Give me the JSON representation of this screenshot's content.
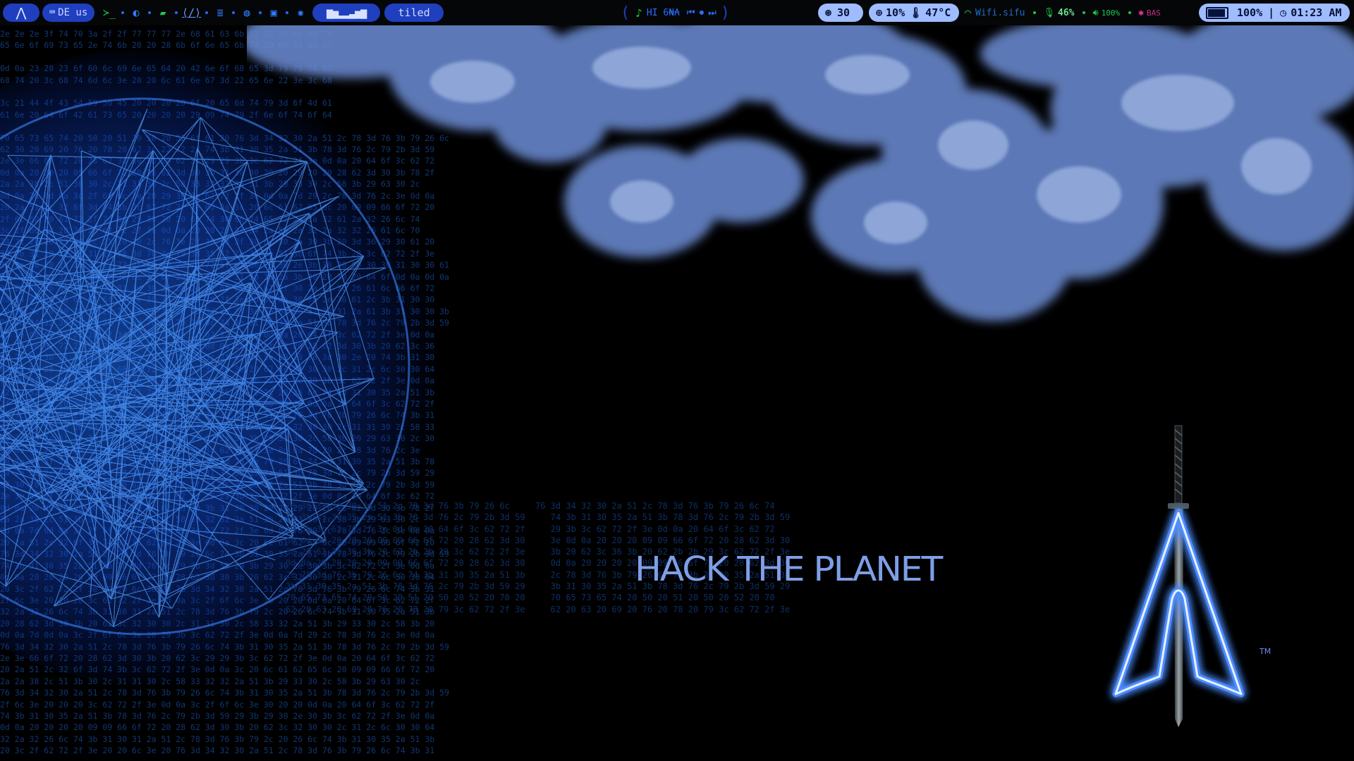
{
  "topbar": {
    "launcher": {
      "icon": "arch-logo-icon"
    },
    "layout": {
      "label": "DE us"
    },
    "apps": [
      {
        "icon": "terminal-icon",
        "glyph": "≻_"
      },
      {
        "icon": "firefox-icon",
        "glyph": "◐"
      },
      {
        "icon": "files-icon",
        "glyph": "▰"
      },
      {
        "icon": "code-icon",
        "glyph": "⟨/⟩"
      },
      {
        "icon": "notes-icon",
        "glyph": "≣"
      },
      {
        "icon": "chat-icon",
        "glyph": "◍"
      },
      {
        "icon": "video-icon",
        "glyph": "▣"
      },
      {
        "icon": "settings-icon",
        "glyph": "✺"
      }
    ],
    "equalizer_label": "▆▅▂▂▃▅▆",
    "workspace": {
      "label": "tiled"
    },
    "media": {
      "title": "HI 6₦₳",
      "prev": "⏮",
      "play": "⏺",
      "next": "⏭"
    },
    "updates": {
      "icon": "arch-update-icon",
      "value": "30"
    },
    "cpu": {
      "icon": "cpu-icon",
      "value": "10%"
    },
    "temp": {
      "icon": "thermometer-icon",
      "value": "47°C"
    },
    "wifi": {
      "icon": "wifi-icon",
      "label": "Wifi.sifu"
    },
    "mic": {
      "icon": "microphone-icon",
      "value": "46%"
    },
    "volume": {
      "icon": "speaker-icon",
      "value": "100%"
    },
    "bluetooth": {
      "icon": "bluetooth-icon",
      "value": "BAS"
    },
    "battery": {
      "icon": "battery-icon",
      "value": "100%",
      "level": 1.0
    },
    "clock": {
      "icon": "clock-icon",
      "value": "01:23 AM"
    }
  },
  "wallpaper": {
    "headline": "HACK THE PLANET",
    "trademark": "TM",
    "hex_lines": [
      "2e 2e 2e 3f 74 70 3a 2f 2f 77 77 77 2e 68 61 63 6b 65 72 2e 6e 65 74",
      "65 6e 6f 69 73 65 2e 74 6b 20 20 28 6b 6f 6e 65 6b 74 20 64 65 6e 6f",
      "",
      "0d 0a 23 20 23 6f 60 6c 69 6e 65 64 20 42 6e 6f 68 65 3d 79 79 74 65",
      "68 74 20 3c 68 74 6d 6c 3e 20 20 6c 61 6e 67 3d 22 65 6e 22 3e 3c 68",
      "",
      "3c 21 44 4f 43 54 59 50 45 20 20 20 20 6f 20 65 6d 74 79 3d 6f 4d 61",
      "61 6e 20 64 6f 42 61 73 65 20 20 20 20 29 09 74 79 2f 6e 6f 74 6f 64",
      "",
      "70 65 73 65 74 20 50 20 51 20 50 20 52 6f 61 20 76 3d 34 32 30 2a 51 2c 78 3d 76 3b 79 26 6c",
      "62 30 20 69 20 76 20 78 20 62 3c 22 72 2f 74 3b 31 30 35 2a 51 3b 78 3d 76 2c 79 2b 3d 59",
      "2e 3e 66 6f 72 20 28 62 3d 30 3b 20 62 3c 29 29 3b 3c 62 72 2f 3e 0d 0a 20 64 6f 3c 62 72",
      "0d 0a 20 20 20 09 66 6f 72 20 28 62 3d 30 3b 31 30 30 20 20 29 20 20 28 62 3d 30 3b 78 2f",
      "2a 2a 38 2c 51 3b 30 2c 31 31 30 2c 58 33 32 32 2a 51 3b 29 33 30 2c 58 3b 29 63 30 2c",
      "0d 0a 7d 0d 0a 3c 2f 6f 6c 3e 20 29 3b 3c 62 72 2f 3e 0d 0a 7d 29 2c 78 3d 76 2c 3e 0d 0a",
      "20 2a 51 2c 32 6f 3d 74 3b 3c 62 72 2f 3e 0d 0a 3c 20 6c 61 62 65 6c 20 09 09 66 6f 72 20",
      "2f 6c 62 20 61 73 2f 7d 6e 29 30 20 20 61 74 30 66 74 65 72 2a 2a 32 61 2a 32 26 6c 74",
      "3c 2f 66 20 20 20 20 62 72 2f 3e 0d 0a 20 20 20 34 34 2a 50 2a 32 2a 32 32 26 61 6c 70",
      "74 2c 20 20 33 30 2c 21 20 20 2c 76 3e 2f 30 3a 3f 30 6c 30 3a 30 3b 20 3d 36 29 30 61 20",
      "74 3b 31 30 2c 2e 31 2a 78 3d 76 2c 79 3d 35 32 2e 33 3a 51 3b 6f 74 3b 28 3c 62 72 2f 3e",
      "3d 3e 30 20 20 20 3c 62 72 2f 3e 30 2e 70 72 6f 6f 66 20 30 2e 3b 30 30 50 30 30 31 30 30 61",
      "35 6f 32 30 31 33 20 6e 20 6c 20 6f 20 32 30 2e 31 20 30 2a 3b 30 20 30 20 64 6f 0d 0a 0d 0a",
      "30 20 30 3b 31 30 2c 36 31 3d 30 20 2a 2e 72 6f 6f 78 61 2f 30 2a 2f 36 26 61 6c 66 6f 72",
      "0a 64 6f 6e 65 62 64 6f 74 2e 36 34 20 30 20 2f 3e 3b 3b 2a 30 78 2e 36 61 2c 3b 31 30 30",
      "20 3f 2e 30 30 20 3f 20 20 20 20 30 20 78 3d 79 2f 3e 3e 0d 0a 32 32 31 2a 61 3b 31 30 30 3b",
      "76 3d 34 32 30 2a 51 2c 78 3d 76 3b 79 26 6c 74 3b 31 30 35 2a 51 3b 78 3d 76 2c 79 2b 3d 59",
      "2d 3e 66 6f 72 20 28 62 3d 30 3b 29 3b 3c 62 72 2f 3e 0d 0a 20 64 6f 3c 62 72 2f 3e 0d 0a",
      "20 20 3c 62 72 2f 3e 20 20 20 20 2e 30 30 0d 0a 20 66 6f 72 20 28 62 3d 30 3b 20 62 3c 36",
      "6f 2f 6c 3b 31 30 2a 6d 2f 62 76 3e 0d 0a 3c 2f 6f 6c 3e 20 20 78 3d 30 2e 20 74 3b 31 30",
      "0d 0a 20 20 20 20 09 09 66 6f 72 20 28 62 3d 30 3b 20 62 3c 32 30 30 2c 31 2c 6c 30 30 64",
      "74 3b 31 30 35 2a 51 3b 78 3d 76 2c 79 2b 3d 59 29 3b 29 30 2e 30 3b 3c 62 72 2f 3e 0d 0a",
      "32 2a 32 26 6c 74 3b 31 30 31 2a 51 2c 78 3d 76 3b 79 2c 20 26 6c 74 3b 31 30 35 2a 51 3b",
      "2f 6c 3e 20 20 20 3c 62 72 2f 3e 0d 0a 3c 2f 6f 6c 3e 30 20 20 0d 0a 20 64 6f 3c 62 72 2f",
      "20 3c 2f 62 72 2f 3e 20 20 6c 3e 20 76 3d 34 32 30 2a 51 2c 78 3d 76 3b 79 26 6c 74 3b 31",
      "0d 0a 20 20 20 20 09 09 66 6f 72 20 28 62 3d 30 3b 20 62 3c 32 30 30 2c 31 31 30 2c 58 33",
      "2a 2a 38 2c 51 3b 30 2c 31 31 30 2c 58 33 32 2a 51 3b 29 33 30 2c 58 3b 20 29 63 30 2c 30",
      "3e 0d 0a 7d 0d 0a 3c 2f 6f 6c 3e 20 29 3b 3c 62 72 2f 3e 0d 0a 7d 29 2c 78 3d 76 2c 3e",
      "30 2a 51 2f 26 6c 74 3b 31 30 35 2a 51 2c 78 3d 76 3b 79 26 6c 74 3b 31 30 35 2a 51 3b 78",
      "2a 2a 32 2c 38 2a 32 2a 32 30 26 6c 74 3b 31 30 30 35 2a 51 3b 78 3d 76 2c 79 2b 3d 59 29",
      "62 30 20 69 20 76 20 78 20 62 3c 22 72 2f 74 3b 31 30 35 2a 51 3b 78 3d 76 2c 79 2b 3d 59",
      "2e 3e 66 6f 72 20 28 62 3d 30 3b 20 62 3c 29 29 3b 3c 62 72 2f 3e 0d 0a 20 64 6f 3c 62 72",
      "0d 0a 20 20 20 09 66 6f 72 20 28 62 3d 30 3b 31 30 30 20 20 29 20 20 28 62 3d 30 3b 78 2f",
      "2a 2a 38 2c 51 3b 30 2c 31 31 30 2c 58 33 32 32 2a 51 3b 29 33 30 2c 58 3b 29 63 30 2c",
      "0d 0a 7d 0d 0a 3c 2f 6f 6c 3e 20 29 3b 3c 62 72 2f 3e 0d 0a 7d 29 2c 78 3d 76 2c 3e 0d 0a",
      "20 2a 51 2c 32 6f 3d 74 3b 3c 62 72 2f 3e 0d 0a 3c 20 6c 61 62 65 6c 20 09 09 66 6f 72 20",
      "76 3d 34 32 30 2a 51 2c 78 3d 76 3b 79 26 6c 74 3b 31 30 35 2a 51 3b 78 3d 76 2c 79 2b 3d 59",
      "74 3b 31 30 35 2a 51 3b 78 3d 76 2c 79 2b 3d 59 29 3b 29 30 2e 30 3b 3c 62 72 2f 3e 0d 0a",
      "0d 0a 20 20 20 20 09 09 66 6f 72 20 28 62 3d 30 3b 20 62 3c 32 30 30 2c 31 2c 6c 30 30 64",
      "20 3c 2f 62 72 2f 3e 20 20 6c 3e 20 76 3d 34 32 30 2a 51 2c 78 3d 76 3b 79 26 6c 74 3b 31",
      "2f 6c 3e 20 20 20 3c 62 72 2f 3e 0d 0a 3c 2f 6f 6c 3e 30 20 20 0d 0a 20 64 6f 3c 62 72 2f",
      "32 2a 32 26 6c 74 3b 31 30 31 2a 51 2c 78 3d 76 3b 79 2c 20 26 6c 74 3b 31 30 35 2a 51 3b",
      "20 28 62 3d 30 3b 20 62 3c 32 30 30 2c 31 31 30 2c 58 33 32 2a 51 3b 29 33 30 2c 58 3b 20",
      "0d 0a 7d 0d 0a 3c 2f 6f 6c 3e 20 29 3b 3c 62 72 2f 3e 0d 0a 7d 29 2c 78 3d 76 2c 3e 0d 0a",
      "76 3d 34 32 30 2a 51 2c 78 3d 76 3b 79 26 6c 74 3b 31 30 35 2a 51 3b 78 3d 76 2c 79 2b 3d 59",
      "2e 3e 66 6f 72 20 28 62 3d 30 3b 20 62 3c 29 29 3b 3c 62 72 2f 3e 0d 0a 20 64 6f 3c 62 72",
      "20 2a 51 2c 32 6f 3d 74 3b 3c 62 72 2f 3e 0d 0a 3c 20 6c 61 62 65 6c 20 09 09 66 6f 72 20",
      "2a 2a 38 2c 51 3b 30 2c 31 31 30 2c 58 33 32 32 2a 51 3b 29 33 30 2c 58 3b 29 63 30 2c",
      "76 3d 34 32 30 2a 51 2c 78 3d 76 3b 79 26 6c 74 3b 31 30 35 2a 51 3b 78 3d 76 2c 79 2b 3d 59",
      "2f 6c 3e 20 20 20 3c 62 72 2f 3e 0d 0a 3c 2f 6f 6c 3e 30 20 20 0d 0a 20 64 6f 3c 62 72 2f",
      "74 3b 31 30 35 2a 51 3b 78 3d 76 2c 79 2b 3d 59 29 3b 29 30 2e 30 3b 3c 62 72 2f 3e 0d 0a",
      "0d 0a 20 20 20 20 09 09 66 6f 72 20 28 62 3d 30 3b 20 62 3c 32 30 30 2c 31 2c 6c 30 30 64",
      "32 2a 32 26 6c 74 3b 31 30 31 2a 51 2c 78 3d 76 3b 79 2c 20 26 6c 74 3b 31 30 35 2a 51 3b",
      "20 3c 2f 62 72 2f 3e 20 20 6c 3e 20 76 3d 34 32 30 2a 51 2c 78 3d 76 3b 79 26 6c 74 3b 31"
    ],
    "hex_block": [
      "76 3d 34 32 30 2a 51 2c 78 3d 76 3b 79 26 6c     76 3d 34 32 30 2a 51 2c 78 3d 76 3b 79 26 6c 74",
      "74 3b 31 30 35 2a 51 3b 78 3d 76 2c 79 2b 3d 59     74 3b 31 30 35 2a 51 3b 78 3d 76 2c 79 2b 3d 59",
      "29 3b 3c 62 72 2f 3e 0d 0a 20 64 6f 3c 62 72 2f     29 3b 3c 62 72 2f 3e 0d 0a 20 64 6f 3c 62 72",
      "3e 0d 0a 20 20 20 09 09 66 6f 72 20 28 62 3d 30     3e 0d 0a 20 20 20 09 09 66 6f 72 20 28 62 3d 30",
      "3b 20 62 3c 36 3b 20 62 2b 2b 29 3c 62 72 2f 3e     3b 20 62 3c 36 3b 20 62 2b 2b 29 3c 62 72 2f 3e",
      "0d 0a 20 20 20 20 09 09 66 6f 72 20 28 62 3d 30     0d 0a 20 20 20 20 09 09 66 6f 72 20 28 62 3d 30",
      "2c 78 3d 76 3b 79 26 6c 74 3b 31 30 35 2a 51 3b     2c 78 3d 76 3b 79 26 6c 74 3b 31 30 35 2a 51 3b",
      "3b 31 30 35 2a 51 3b 78 3d 76 2c 79 2b 3d 59 29     3b 31 30 35 2a 51 3b 78 3d 76 2c 79 2b 3d 59 29",
      "70 65 73 65 74 20 50 20 51 20 50 20 52 20 70 20     70 65 73 65 74 20 50 20 51 20 50 20 52 20 70",
      "62 20 63 20 69 20 76 20 78 20 79 3c 62 72 2f 3e     62 20 63 20 69 20 76 20 78 20 79 3c 62 72 2f 3e"
    ]
  },
  "colors": {
    "bar_bg": "#050608",
    "pill_blue": "#1f3fbf",
    "pill_light": "#9fbcff",
    "accent_green": "#1ec94a",
    "headline": "#7e9ee8",
    "hex_text": "#123a7a"
  }
}
